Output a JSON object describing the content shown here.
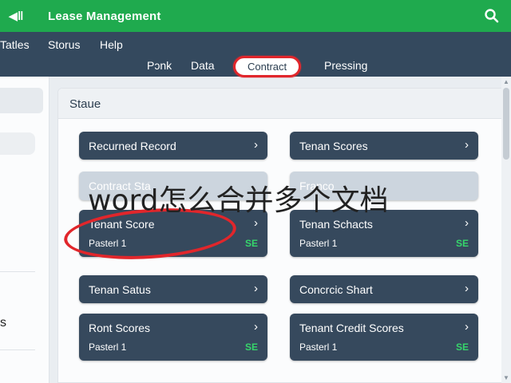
{
  "header": {
    "back_icon": "back-arrow-icon",
    "title": "Lease Management",
    "search_icon": "search-icon"
  },
  "menu": [
    "Tatles",
    "Storus",
    "Help"
  ],
  "tabs": [
    {
      "label": "Pɔnk",
      "active": false
    },
    {
      "label": "Data",
      "active": false
    },
    {
      "label": "Contract",
      "active": true
    },
    {
      "label": "Pressing",
      "active": false
    }
  ],
  "left_panel": {
    "text": "s"
  },
  "main": {
    "title": "Staue",
    "cards": [
      {
        "title": "Recurned Record",
        "sub": "",
        "badge": ""
      },
      {
        "title": "Tenan Scores",
        "sub": "",
        "badge": ""
      },
      {
        "title": "Contract Sta",
        "sub": "",
        "badge": ""
      },
      {
        "title": "Franco",
        "sub": "",
        "badge": ""
      },
      {
        "title": "Tenant Score",
        "sub": "Pasterl 1",
        "badge": "SE"
      },
      {
        "title": "Tenan Schacts",
        "sub": "Pasterl 1",
        "badge": "SE"
      },
      {
        "title": "Tenan Satus",
        "sub": "",
        "badge": ""
      },
      {
        "title": "Concrcic Shart",
        "sub": "",
        "badge": ""
      },
      {
        "title": "Ront Scores",
        "sub": "Pasterl 1",
        "badge": "SE"
      },
      {
        "title": "Tenant Credit Scores",
        "sub": "Pasterl 1",
        "badge": "SE"
      }
    ]
  },
  "overlay_text": "word怎么合并多个文档",
  "colors": {
    "header_bg": "#1faa4e",
    "menubar_bg": "#34495e",
    "card_bg": "#36495d",
    "badge": "#36d66b",
    "annotation": "#e1262b"
  }
}
